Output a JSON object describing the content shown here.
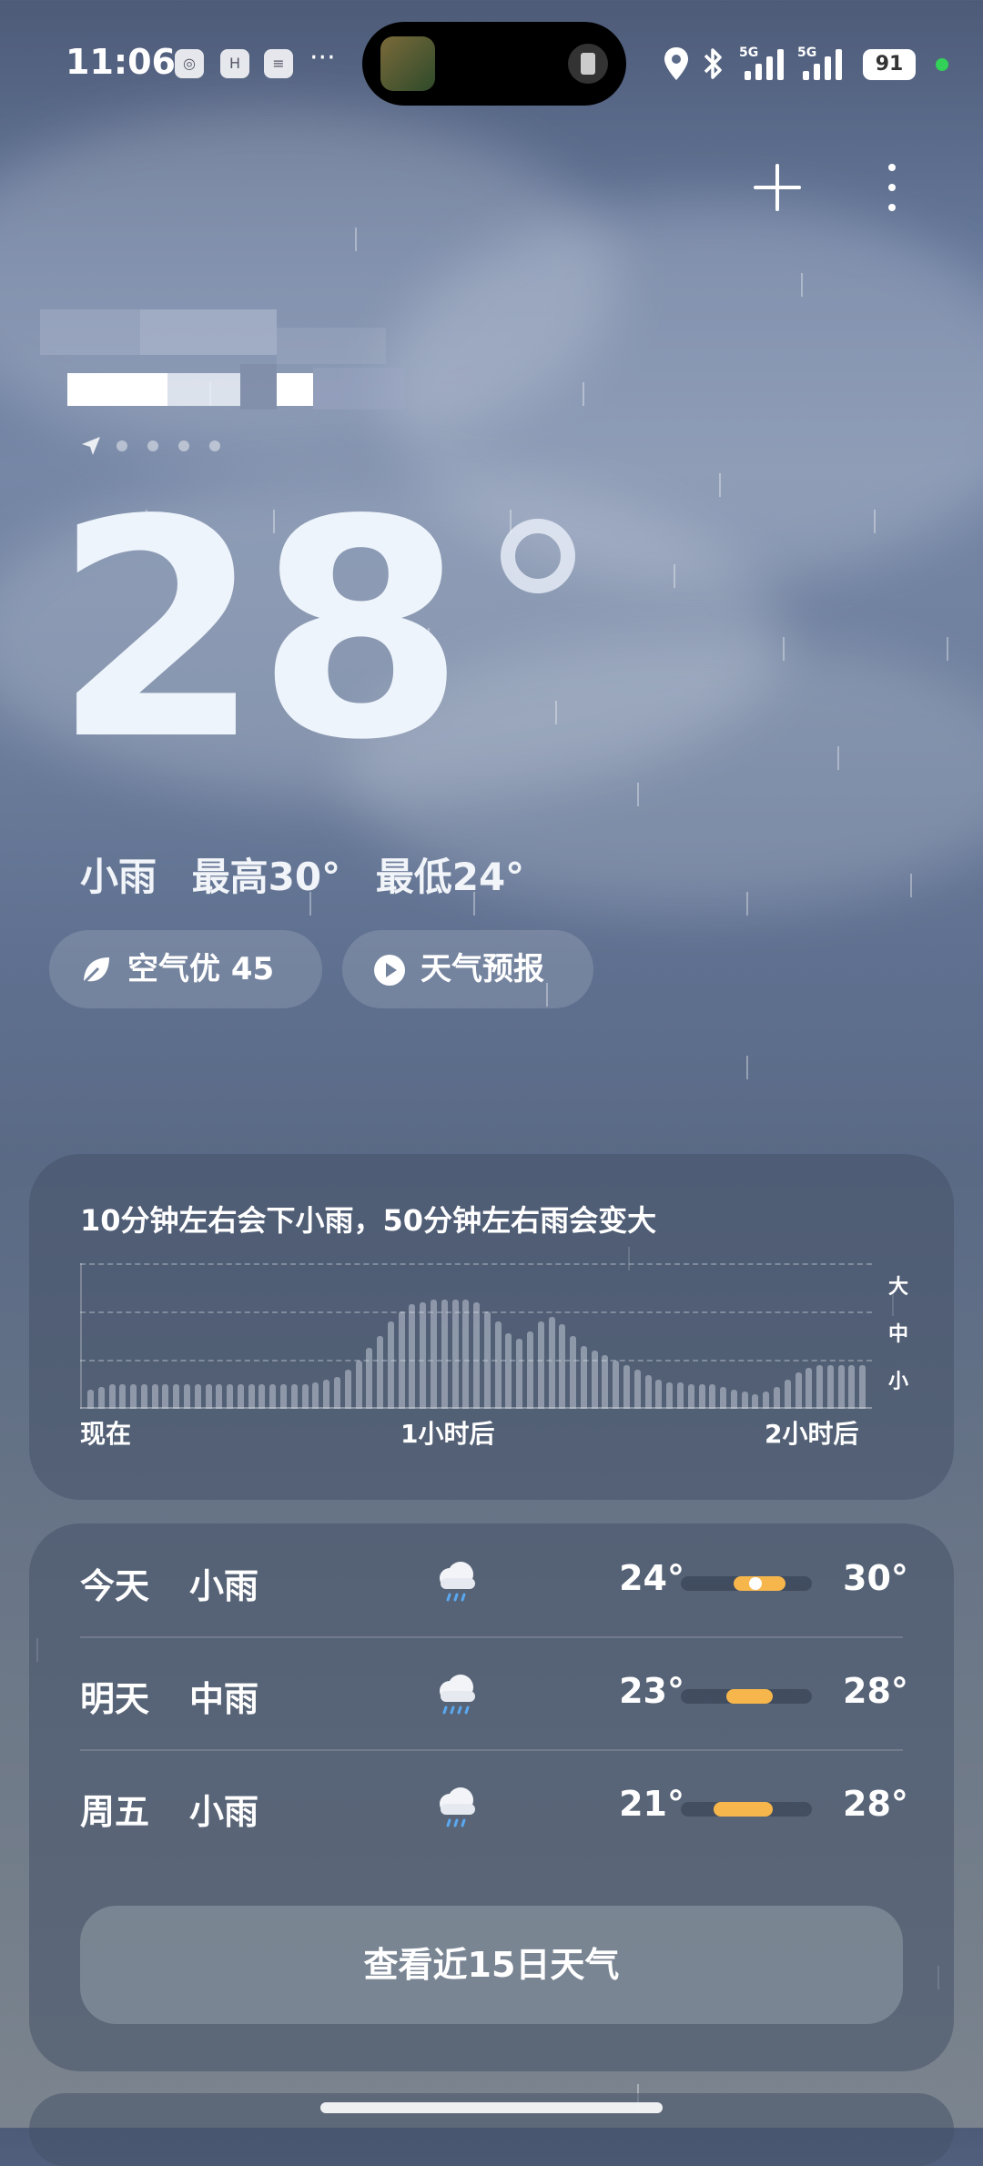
{
  "status_bar": {
    "time": "11:06",
    "app_icons": [
      "sphere-app-icon",
      "h-app-icon",
      "notes-app-icon"
    ],
    "more": "···",
    "sim1": "5G",
    "sim2": "5G",
    "battery": "91"
  },
  "weather": {
    "temperature": "28",
    "condition": "小雨",
    "high": "最高30°",
    "low": "最低24°"
  },
  "pills": {
    "air_quality": "空气优 45",
    "forecast_video": "天气预报"
  },
  "rain_card": {
    "title": "10分钟左右会下小雨，50分钟左右雨会变大",
    "y_labels": [
      "大",
      "中",
      "小"
    ],
    "x_labels": [
      "现在",
      "1小时后",
      "2小时后"
    ]
  },
  "chart_data": {
    "type": "bar",
    "title": "10分钟左右会下小雨，50分钟左右雨会变大",
    "x_tick_labels": [
      "现在",
      "1小时后",
      "2小时后"
    ],
    "y_tick_labels": [
      "小",
      "中",
      "大"
    ],
    "ylim": [
      0,
      3
    ],
    "values": [
      0.4,
      0.45,
      0.5,
      0.5,
      0.5,
      0.5,
      0.5,
      0.5,
      0.5,
      0.5,
      0.5,
      0.5,
      0.5,
      0.5,
      0.5,
      0.5,
      0.5,
      0.5,
      0.5,
      0.5,
      0.5,
      0.55,
      0.6,
      0.65,
      0.8,
      1.0,
      1.25,
      1.5,
      1.8,
      2.0,
      2.15,
      2.2,
      2.25,
      2.25,
      2.25,
      2.25,
      2.2,
      2.0,
      1.8,
      1.55,
      1.45,
      1.6,
      1.8,
      1.9,
      1.75,
      1.5,
      1.3,
      1.2,
      1.1,
      1.0,
      0.9,
      0.8,
      0.7,
      0.6,
      0.55,
      0.55,
      0.5,
      0.5,
      0.5,
      0.45,
      0.4,
      0.35,
      0.3,
      0.35,
      0.45,
      0.6,
      0.75,
      0.85,
      0.9,
      0.9,
      0.9,
      0.9,
      0.9
    ],
    "grid": true
  },
  "forecast": {
    "days": [
      {
        "day": "今天",
        "condition": "小雨",
        "icon": "light-rain-icon",
        "low": "24°",
        "high": "30°",
        "range_start": 0.4,
        "range_end": 0.8,
        "current": 0.55
      },
      {
        "day": "明天",
        "condition": "中雨",
        "icon": "moderate-rain-icon",
        "low": "23°",
        "high": "28°",
        "range_start": 0.35,
        "range_end": 0.7
      },
      {
        "day": "周五",
        "condition": "小雨",
        "icon": "light-rain-icon",
        "low": "21°",
        "high": "28°",
        "range_start": 0.25,
        "range_end": 0.7
      }
    ],
    "button": "查看近15日天气"
  },
  "colors": {
    "accent_range": "#f6b64b",
    "status_dot": "#32d158"
  }
}
